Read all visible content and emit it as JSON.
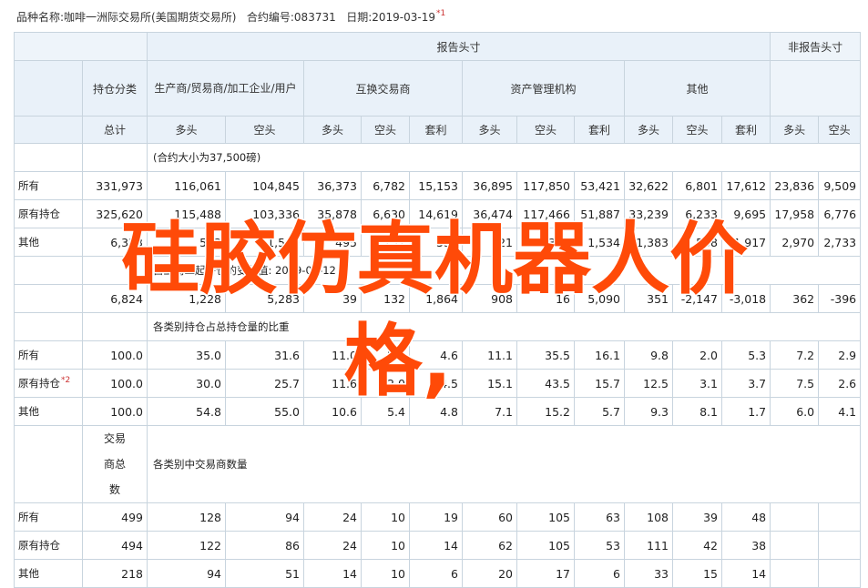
{
  "header": {
    "product": "品种名称:咖啡一洲际交易所(美国期货交易所)",
    "code": "合约编号:083731",
    "date": "日期:2019-03-19",
    "note_marker": "*1"
  },
  "table": {
    "col_groups": {
      "reported": "报告头寸",
      "nonreported": "非报告头寸"
    },
    "holding_category": "持仓分类",
    "trader_groups": {
      "producer": "生产商/贸易商/加工企业/用户",
      "swap": "互换交易商",
      "managed": "资产管理机构",
      "other": "其他"
    },
    "sub_headers": {
      "total": "总计",
      "long": "多头",
      "short": "空头",
      "spread": "套利"
    },
    "sections": [
      {
        "title": "(合约大小为37,500磅)",
        "left_label": "",
        "rows": [
          {
            "label": "所有",
            "note": "",
            "values": [
              "331,973",
              "116,061",
              "104,845",
              "36,373",
              "6,782",
              "15,153",
              "36,895",
              "117,850",
              "53,421",
              "32,622",
              "6,801",
              "17,612",
              "23,836",
              "9,509"
            ]
          },
          {
            "label": "原有持仓",
            "note": "",
            "values": [
              "325,620",
              "115,488",
              "103,336",
              "35,878",
              "6,630",
              "14,619",
              "36,474",
              "117,466",
              "51,887",
              "33,239",
              "6,233",
              "9,695",
              "17,958",
              "6,776"
            ]
          },
          {
            "label": "其他",
            "note": "",
            "values": [
              "6,353",
              "573",
              "1,509",
              "495",
              "152",
              "534",
              "421",
              "384",
              "1,534",
              "1,383",
              "568",
              "1,917",
              "2,970",
              "2,733"
            ]
          }
        ]
      },
      {
        "title": "自上周二起持仓的变化值: 2019-03-12",
        "left_label": "",
        "rows": [
          {
            "label": "",
            "note": "",
            "values": [
              "6,824",
              "1,228",
              "5,283",
              "39",
              "132",
              "1,864",
              "908",
              "16",
              "5,090",
              "351",
              "-2,147",
              "-3,018",
              "362",
              "-396"
            ]
          }
        ]
      },
      {
        "title": "各类别持仓占总持仓量的比重",
        "left_label": "",
        "rows": [
          {
            "label": "所有",
            "note": "",
            "values": [
              "100.0",
              "35.0",
              "31.6",
              "11.0",
              "2.0",
              "4.6",
              "11.1",
              "35.5",
              "16.1",
              "9.8",
              "2.0",
              "5.3",
              "7.2",
              "2.9"
            ]
          },
          {
            "label": "原有持仓",
            "note": "*2",
            "values": [
              "100.0",
              "30.0",
              "25.7",
              "11.6",
              "2.0",
              "4.5",
              "15.1",
              "43.5",
              "15.7",
              "12.5",
              "3.1",
              "3.7",
              "7.5",
              "2.6"
            ]
          },
          {
            "label": "其他",
            "note": "",
            "values": [
              "100.0",
              "54.8",
              "55.0",
              "10.6",
              "5.4",
              "4.8",
              "7.1",
              "15.2",
              "5.7",
              "9.3",
              "8.1",
              "1.7",
              "6.0",
              "4.1"
            ]
          }
        ]
      },
      {
        "title": "各类别中交易商数量",
        "left_label": "交易商总数",
        "rows": [
          {
            "label": "所有",
            "note": "",
            "values": [
              "499",
              "128",
              "94",
              "24",
              "10",
              "19",
              "60",
              "105",
              "63",
              "108",
              "39",
              "48",
              "",
              ""
            ]
          },
          {
            "label": "原有持仓",
            "note": "",
            "values": [
              "494",
              "122",
              "86",
              "24",
              "10",
              "14",
              "62",
              "105",
              "53",
              "111",
              "42",
              "38",
              "",
              ""
            ]
          },
          {
            "label": "其他",
            "note": "",
            "values": [
              "218",
              "94",
              "51",
              "14",
              "10",
              "6",
              "20",
              "17",
              "6",
              "33",
              "15",
              "14",
              "",
              ""
            ]
          }
        ]
      }
    ]
  },
  "overlay": {
    "line1": "硅胶仿真机器人价",
    "line2": "格,",
    "color": "#ff4a08"
  }
}
